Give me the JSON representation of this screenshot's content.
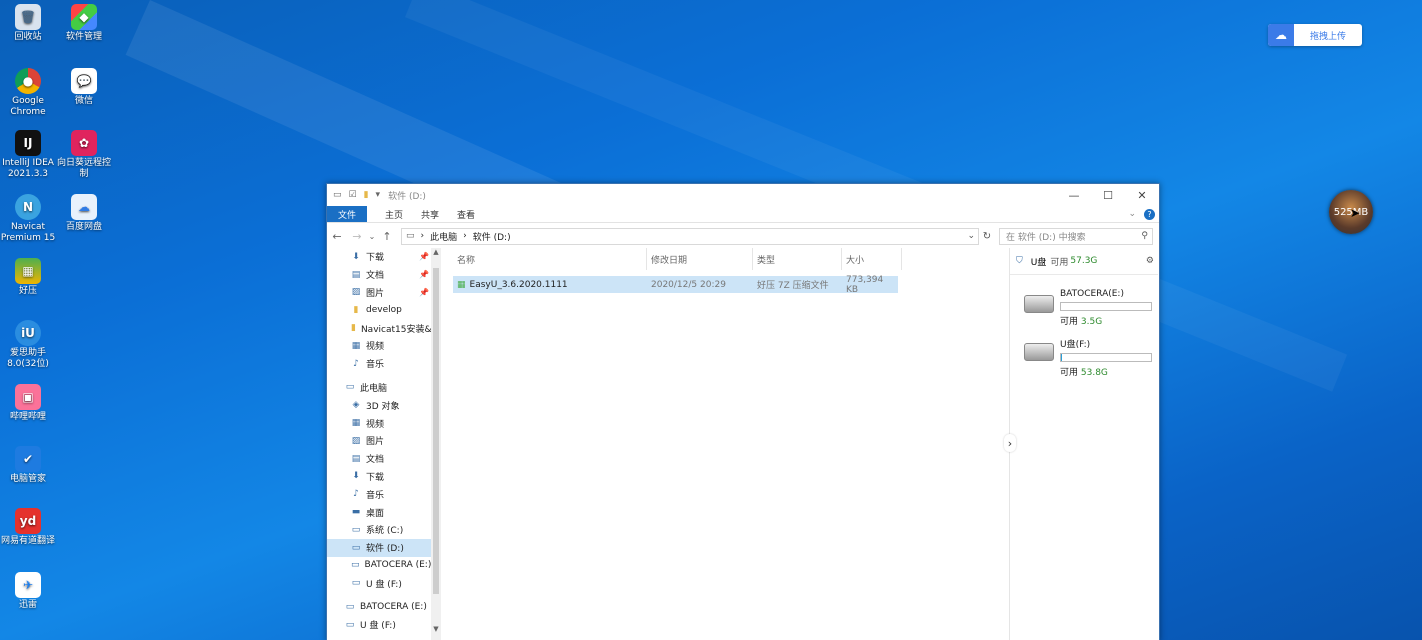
{
  "desktop": {
    "icons": [
      {
        "label": "回收站",
        "icon": "recycle-bin-icon"
      },
      {
        "label": "软件管理",
        "icon": "software-manager-icon"
      },
      {
        "label": "Google Chrome",
        "icon": "chrome-icon"
      },
      {
        "label": "微信",
        "icon": "wechat-icon"
      },
      {
        "label": "IntelliJ IDEA 2021.3.3",
        "icon": "intellij-icon"
      },
      {
        "label": "向日葵远程控制",
        "icon": "sunflower-remote-icon"
      },
      {
        "label": "Navicat Premium 15",
        "icon": "navicat-icon"
      },
      {
        "label": "百度网盘",
        "icon": "baidu-netdisk-icon"
      },
      {
        "label": "好压",
        "icon": "haozip-icon"
      },
      {
        "label": "爱思助手 8.0(32位)",
        "icon": "i4-assistant-icon"
      },
      {
        "label": "哔哩哔哩",
        "icon": "bilibili-icon"
      },
      {
        "label": "电脑管家",
        "icon": "pc-manager-icon"
      },
      {
        "label": "网易有道翻译",
        "icon": "youdao-icon"
      },
      {
        "label": "迅雷",
        "icon": "xunlei-icon"
      }
    ]
  },
  "upload_widget": {
    "label": "拖拽上传",
    "icon": "baidu-cloud-icon"
  },
  "floating_ball": {
    "label": "525MB"
  },
  "window": {
    "title": "软件 (D:)",
    "controls": {
      "minimize": "—",
      "maximize": "☐",
      "close": "✕"
    },
    "ribbon": {
      "file": "文件",
      "tabs": [
        "主页",
        "共享",
        "查看"
      ],
      "help": "?"
    },
    "address": {
      "parts": [
        "此电脑",
        "软件 (D:)"
      ]
    },
    "search": {
      "placeholder": "在 软件 (D:) 中搜索"
    },
    "nav": [
      {
        "label": "下载",
        "pinned": true,
        "top": false
      },
      {
        "label": "文档",
        "pinned": true,
        "top": false
      },
      {
        "label": "图片",
        "pinned": true,
        "top": false
      },
      {
        "label": "develop",
        "pinned": false,
        "top": false
      },
      {
        "label": "Navicat15安装&",
        "pinned": false,
        "top": false
      },
      {
        "label": "视频",
        "pinned": false,
        "top": false
      },
      {
        "label": "音乐",
        "pinned": false,
        "top": false
      },
      {
        "label": "此电脑",
        "pinned": false,
        "top": true
      },
      {
        "label": "3D 对象",
        "pinned": false,
        "top": false
      },
      {
        "label": "视频",
        "pinned": false,
        "top": false
      },
      {
        "label": "图片",
        "pinned": false,
        "top": false
      },
      {
        "label": "文档",
        "pinned": false,
        "top": false
      },
      {
        "label": "下载",
        "pinned": false,
        "top": false
      },
      {
        "label": "音乐",
        "pinned": false,
        "top": false
      },
      {
        "label": "桌面",
        "pinned": false,
        "top": false
      },
      {
        "label": "系统 (C:)",
        "pinned": false,
        "top": false
      },
      {
        "label": "软件 (D:)",
        "pinned": false,
        "top": false,
        "selected": true
      },
      {
        "label": "BATOCERA (E:)",
        "pinned": false,
        "top": false
      },
      {
        "label": "U 盘 (F:)",
        "pinned": false,
        "top": false
      },
      {
        "label": "BATOCERA (E:)",
        "pinned": false,
        "top": true
      },
      {
        "label": "U 盘 (F:)",
        "pinned": false,
        "top": true
      }
    ],
    "columns": [
      "名称",
      "修改日期",
      "类型",
      "大小"
    ],
    "files": [
      {
        "name": "EasyU_3.6.2020.1111",
        "date": "2020/12/5 20:29",
        "type": "好压 7Z 压缩文件",
        "size": "773,394 KB"
      }
    ],
    "pane": {
      "drive": "U盘",
      "free_label": "可用",
      "free": "57.3G",
      "drives": [
        {
          "name": "BATOCERA(E:)",
          "free_label": "可用",
          "free": "3.5G",
          "used_fraction": 0.0
        },
        {
          "name": "U盘(F:)",
          "free_label": "可用",
          "free": "53.8G",
          "used_fraction": 0.01
        }
      ]
    }
  }
}
